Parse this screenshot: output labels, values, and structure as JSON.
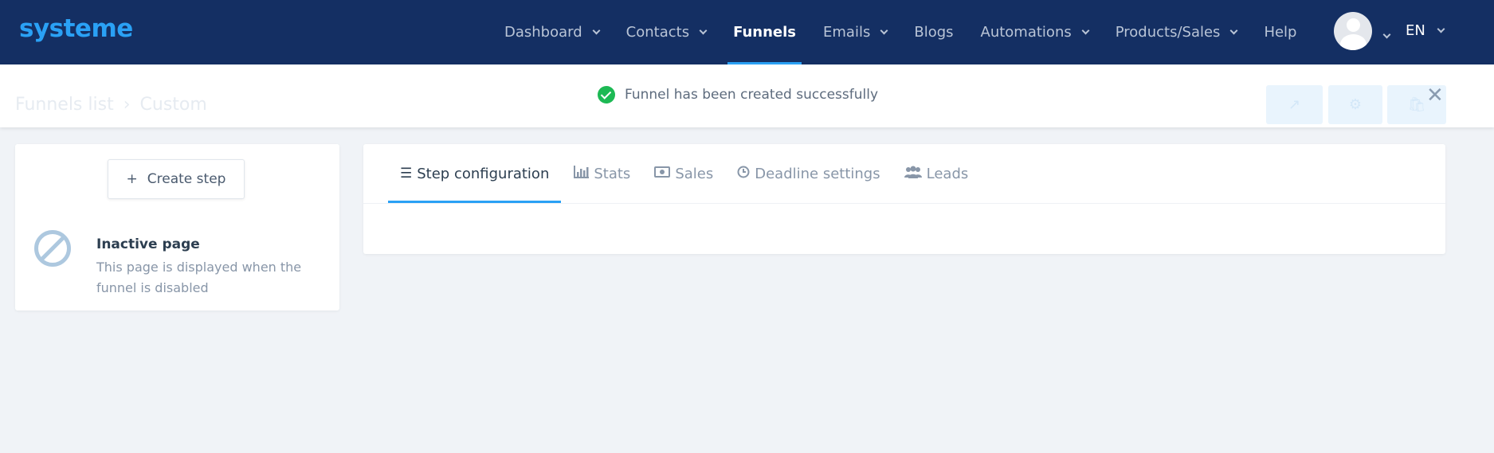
{
  "app": {
    "logo_text": "systeme"
  },
  "nav": {
    "items": [
      {
        "label": "Dashboard",
        "has_dropdown": true
      },
      {
        "label": "Contacts",
        "has_dropdown": true
      },
      {
        "label": "Funnels",
        "has_dropdown": false,
        "active": true
      },
      {
        "label": "Emails",
        "has_dropdown": true
      },
      {
        "label": "Blogs",
        "has_dropdown": false
      },
      {
        "label": "Automations",
        "has_dropdown": true
      },
      {
        "label": "Products/Sales",
        "has_dropdown": true
      },
      {
        "label": "Help",
        "has_dropdown": false
      }
    ],
    "language": "EN"
  },
  "breadcrumb": {
    "root": "Funnels list",
    "current": "Custom"
  },
  "notification": {
    "message": "Funnel has been created successfully",
    "status": "success",
    "status_color": "#1db954"
  },
  "left_panel": {
    "create_step_label": "Create step",
    "inactive_title": "Inactive page",
    "inactive_description": "This page is displayed when the funnel is disabled"
  },
  "tabs": [
    {
      "label": "Step configuration",
      "icon": "list-icon",
      "active": true
    },
    {
      "label": "Stats",
      "icon": "bar-chart-icon"
    },
    {
      "label": "Sales",
      "icon": "money-icon"
    },
    {
      "label": "Deadline settings",
      "icon": "clock-icon"
    },
    {
      "label": "Leads",
      "icon": "users-icon"
    }
  ],
  "colors": {
    "header_bg": "#142f63",
    "accent": "#2aa1f5",
    "page_bg": "#f0f3f7"
  }
}
